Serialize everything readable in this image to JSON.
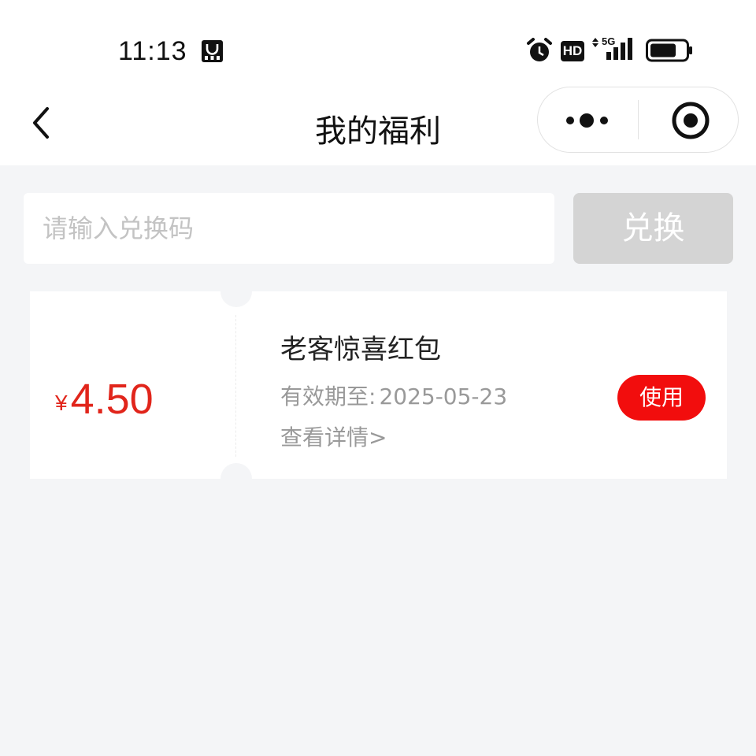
{
  "status_bar": {
    "time": "11:13",
    "icons": [
      "app-notification-icon",
      "alarm-icon",
      "hd-icon",
      "5g-signal-icon",
      "battery-icon"
    ],
    "network_label": "5G",
    "hd_label": "HD"
  },
  "nav": {
    "title": "我的福利",
    "back_icon": "chevron-left-icon",
    "more_icon": "more-dots-icon",
    "close_icon": "target-close-icon"
  },
  "redeem": {
    "placeholder": "请输入兑换码",
    "value": "",
    "button_label": "兑换"
  },
  "coupons": [
    {
      "currency": "¥",
      "amount": "4.50",
      "title": "老客惊喜红包",
      "expiry_label": "有效期至:",
      "expiry_date": "2025-05-23",
      "details_label": "查看详情>",
      "use_label": "使用"
    }
  ],
  "colors": {
    "accent_red": "#e1251b",
    "use_button": "#f20d0d",
    "background": "#f4f5f7",
    "disabled_button": "#d4d4d4"
  }
}
